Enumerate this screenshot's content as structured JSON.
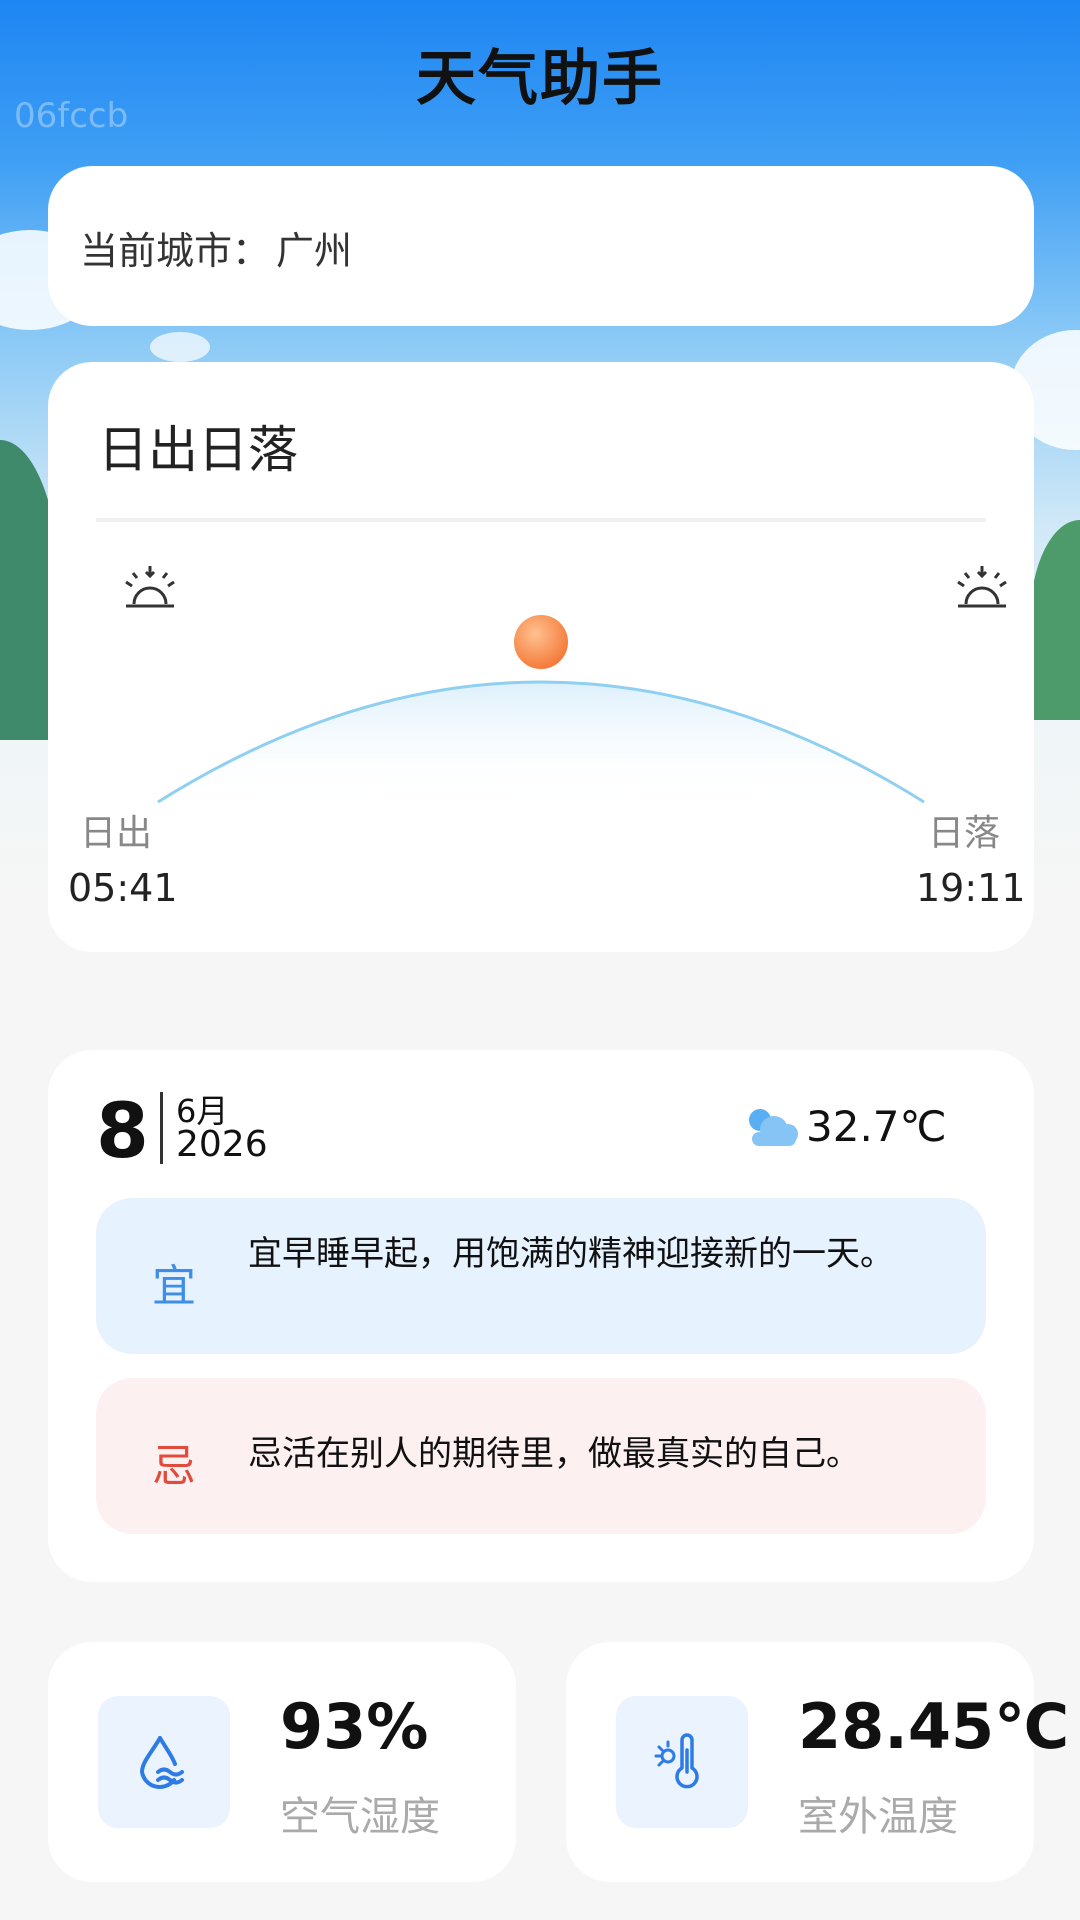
{
  "app": {
    "title": "天气助手",
    "watermark": "06fccb"
  },
  "city": {
    "label": "当前城市：",
    "name": "广州"
  },
  "sun": {
    "title": "日出日落",
    "sunrise_label": "日出",
    "sunrise_time": "05:41",
    "sunset_label": "日落",
    "sunset_time": "19:11",
    "sunrise_icon": "sunrise-icon",
    "sunset_icon": "sunset-icon"
  },
  "date": {
    "day": "8",
    "month": "6月",
    "year": "2026"
  },
  "weather": {
    "icon": "cloud-icon",
    "temperature": "32.7℃"
  },
  "advice": {
    "yi_char": "宜",
    "yi_text": "宜早睡早起，用饱满的精神迎接新的一天。",
    "ji_char": "忌",
    "ji_text": "忌活在别人的期待里，做最真实的自己。"
  },
  "stats": {
    "humidity": {
      "value": "93%",
      "label": "空气湿度",
      "icon": "humidity-icon"
    },
    "outdoor_temp": {
      "value": "28.45℃",
      "label": "室外温度",
      "icon": "thermometer-icon"
    }
  },
  "colors": {
    "accent_blue": "#3d8ee8",
    "accent_red": "#e24a3c",
    "sun_orange": "#f5894a"
  }
}
